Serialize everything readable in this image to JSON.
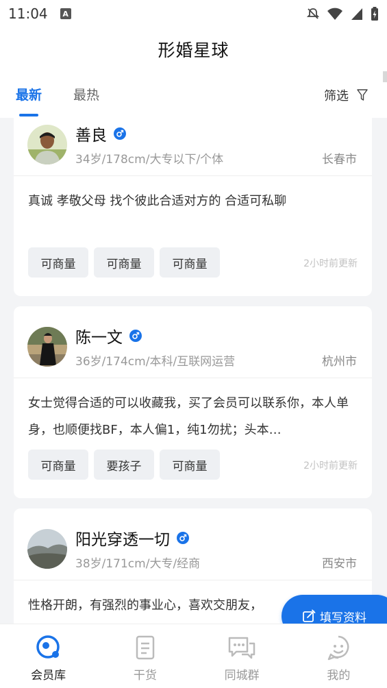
{
  "status": {
    "time": "11:04",
    "keyboard_badge": "A"
  },
  "header": {
    "title": "形婚星球"
  },
  "tabs": [
    {
      "label": "最新"
    },
    {
      "label": "最热"
    }
  ],
  "filter": {
    "label": "筛选"
  },
  "cards": [
    {
      "name": "善良",
      "info": "34岁/178cm/大专以下/个体",
      "city": "长春市",
      "bio": "真诚 孝敬父母 找个彼此合适对方的 合适可私聊",
      "tags": [
        "可商量",
        "可商量",
        "可商量"
      ],
      "updated": "2小时前更新"
    },
    {
      "name": "陈一文",
      "info": "36岁/174cm/本科/互联网运营",
      "city": "杭州市",
      "bio": "女士觉得合适的可以收藏我，买了会员可以联系你，本人单身，也顺便找BF，本人偏1，纯1勿扰；头本…",
      "tags": [
        "可商量",
        "要孩子",
        "可商量"
      ],
      "updated": "2小时前更新"
    },
    {
      "name": "阳光穿透一切",
      "info": "38岁/171cm/大专/经商",
      "city": "西安市",
      "bio": "性格开朗，有强烈的事业心，喜欢交朋友，",
      "tags": [],
      "updated": ""
    }
  ],
  "fab": {
    "label": "填写资料"
  },
  "nav": [
    {
      "label": "会员库",
      "icon": "member-library-icon"
    },
    {
      "label": "干货",
      "icon": "document-icon"
    },
    {
      "label": "同城群",
      "icon": "chat-bubbles-icon"
    },
    {
      "label": "我的",
      "icon": "profile-face-icon"
    }
  ],
  "colors": {
    "accent": "#1a73e8",
    "background": "#f3f4f6"
  }
}
